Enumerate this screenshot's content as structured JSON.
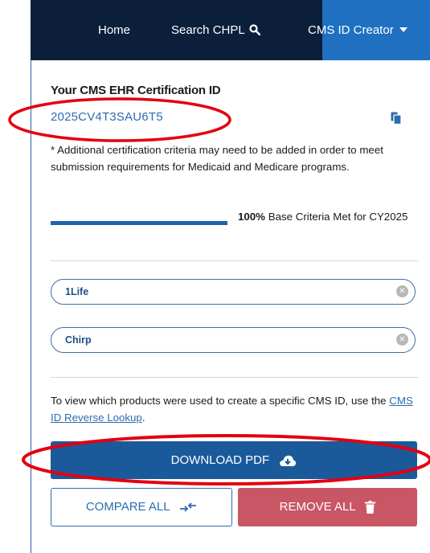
{
  "nav": {
    "home": "Home",
    "search": "Search CHPL",
    "creator": "CMS ID Creator"
  },
  "panel": {
    "heading": "Your CMS EHR Certification ID",
    "cert_id": "2025CV4T3SAU6T5",
    "note": "* Additional certification criteria may need to be added in order to meet submission requirements for Medicaid and Medicare programs.",
    "progress": {
      "percent_value": 100,
      "percent_label": "100%",
      "label": "Base Criteria Met for CY2025"
    },
    "products": [
      "1Life",
      "Chirp"
    ],
    "info_text": "To view which products were used to create a specific CMS ID, use the",
    "info_link": "CMS ID Reverse Lookup",
    "info_end": "."
  },
  "buttons": {
    "download": "DOWNLOAD PDF",
    "compare": "COMPARE ALL",
    "remove": "REMOVE ALL"
  },
  "colors": {
    "navbar": "#0b1f3a",
    "nav_active": "#1f70c1",
    "primary": "#1a5a9b",
    "danger": "#c85665",
    "annotation": "#e3000f"
  }
}
